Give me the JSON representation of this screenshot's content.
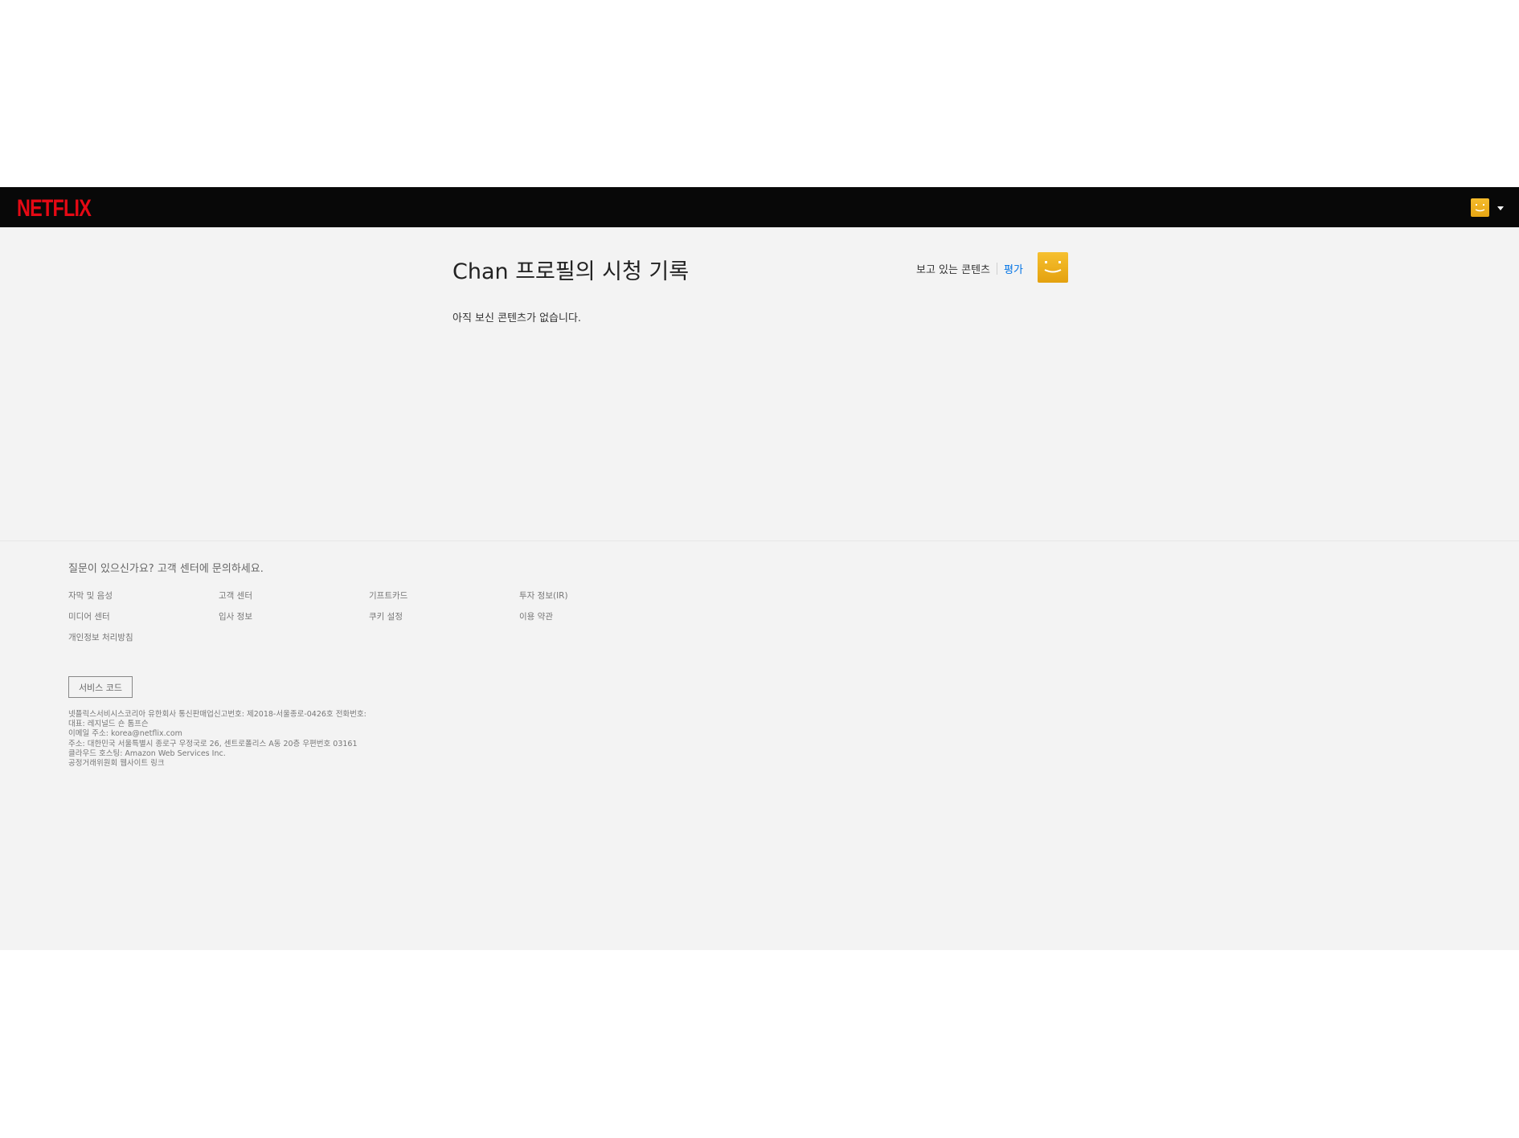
{
  "header": {
    "logo_text": "NETFLIX",
    "brand_color": "#e50914",
    "avatar_icon": "smiley-avatar-icon",
    "menu_icon": "caret-down-icon"
  },
  "main": {
    "title": "Chan 프로필의 시청 기록",
    "tabs": {
      "watching": "보고 있는 콘텐츠",
      "rating": "평가"
    },
    "empty_message": "아직 보신 콘텐츠가 없습니다."
  },
  "footer": {
    "question": "질문이 있으신가요? 고객 센터에 문의하세요.",
    "links": [
      "자막 및 음성",
      "고객 센터",
      "기프트카드",
      "투자 정보(IR)",
      "미디어 센터",
      "입사 정보",
      "쿠키 설정",
      "이용 약관",
      "개인정보 처리방침"
    ],
    "service_code": "서비스 코드",
    "legal": [
      "넷플릭스서비시스코리아 유한회사 통신판매업신고번호: 제2018-서울종로-0426호 전화번호:",
      "대표: 레지널드 숀 톰프슨",
      "이메일 주소: korea@netflix.com",
      "주소: 대한민국 서울특별시 종로구 우정국로 26, 센트로폴리스 A동 20층 우편번호 03161",
      "클라우드 호스팅: Amazon Web Services Inc.",
      "공정거래위원회 웹사이트 링크"
    ]
  }
}
